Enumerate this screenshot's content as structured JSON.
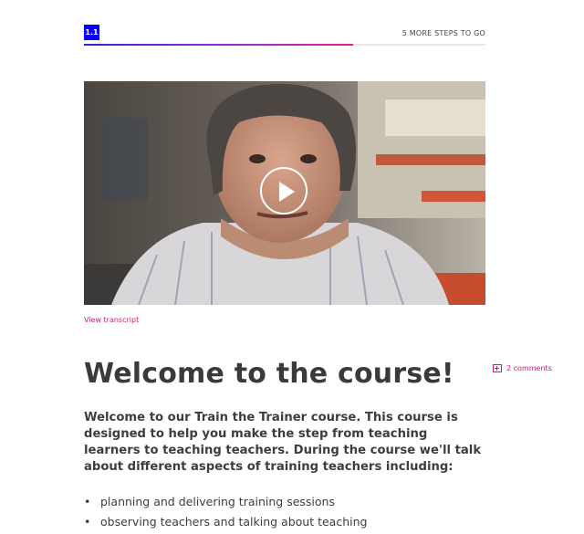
{
  "step": {
    "badge": "1.1",
    "steps_remaining": "5 MORE STEPS TO GO",
    "progress": 0.67
  },
  "video": {
    "play_icon": "play-icon",
    "transcript_link": "View transcript"
  },
  "article": {
    "title": "Welcome to the course!",
    "comments_label": "2 comments",
    "comments_icon": "comment-add-icon",
    "intro": "Welcome to our Train the Trainer course. This course is designed to help you make the step from teaching learners to teaching teachers. During the course we'll talk about different aspects of training teachers including:",
    "bullets": [
      "planning and delivering training sessions",
      "observing teachers and talking about teaching"
    ]
  },
  "colors": {
    "accent_pink": "#d11a7a",
    "badge_blue": "#0a00ff",
    "progress_start": "#3b1ed6",
    "progress_end": "#e0238f"
  }
}
